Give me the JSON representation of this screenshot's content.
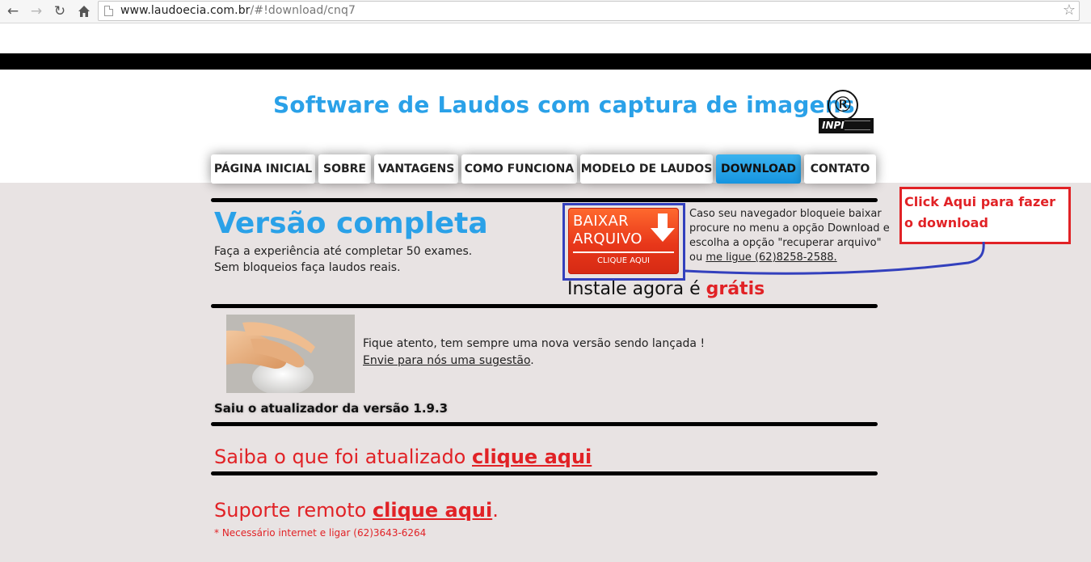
{
  "browser": {
    "url_host": "www.laudoecia.com.br",
    "url_path": "/#!download/cnq7"
  },
  "header": {
    "title": "Software de Laudos com captura de imagens",
    "reg_mark": "®",
    "inpi_label": "INPI"
  },
  "menu": {
    "items": [
      {
        "label": "PÁGINA INICIAL"
      },
      {
        "label": "SOBRE"
      },
      {
        "label": "VANTAGENS"
      },
      {
        "label": "COMO FUNCIONA"
      },
      {
        "label": "MODELO DE LAUDOS"
      },
      {
        "label": "DOWNLOAD"
      },
      {
        "label": "CONTATO"
      }
    ],
    "active": "DOWNLOAD"
  },
  "version": {
    "title": "Versão completa",
    "line1": "Faça a experiência até completar 50 exames.",
    "line2": "Sem bloqueios faça laudos reais."
  },
  "download_button": {
    "line1": "BAIXAR",
    "line2": "ARQUIVO",
    "sub": "CLIQUE AQUI"
  },
  "download_info": {
    "line1": "Caso seu navegador bloqueie baixar",
    "line2": "procure no menu a opção Download e",
    "line3": "escolha a opção \"recuperar arquivo\"",
    "line4_prefix": "ou ",
    "line4_link": "me ligue (62)8258-2588."
  },
  "install": {
    "prefix": "Instale agora é ",
    "highlight": "grátis"
  },
  "annotation": {
    "text": "Click Aqui para fazer o download"
  },
  "updates": {
    "line1": "Fique atento, tem sempre uma nova versão sendo lançada !",
    "suggestion_link": "Envie para nós uma sugestão",
    "suggestion_suffix": ".",
    "saiu": "Saiu o atualizador da versão 1.9.3"
  },
  "saiba": {
    "text": "Saiba o que foi atualizado ",
    "link": "clique aqui"
  },
  "suporte": {
    "text": "Suporte remoto ",
    "link": "clique aqui",
    "suffix": ".",
    "note": "* Necessário internet e ligar (62)3643-6264"
  },
  "colors": {
    "brand_blue": "#2aa1e8",
    "accent_red": "#e12226",
    "annotation_blue": "#3340bd"
  }
}
